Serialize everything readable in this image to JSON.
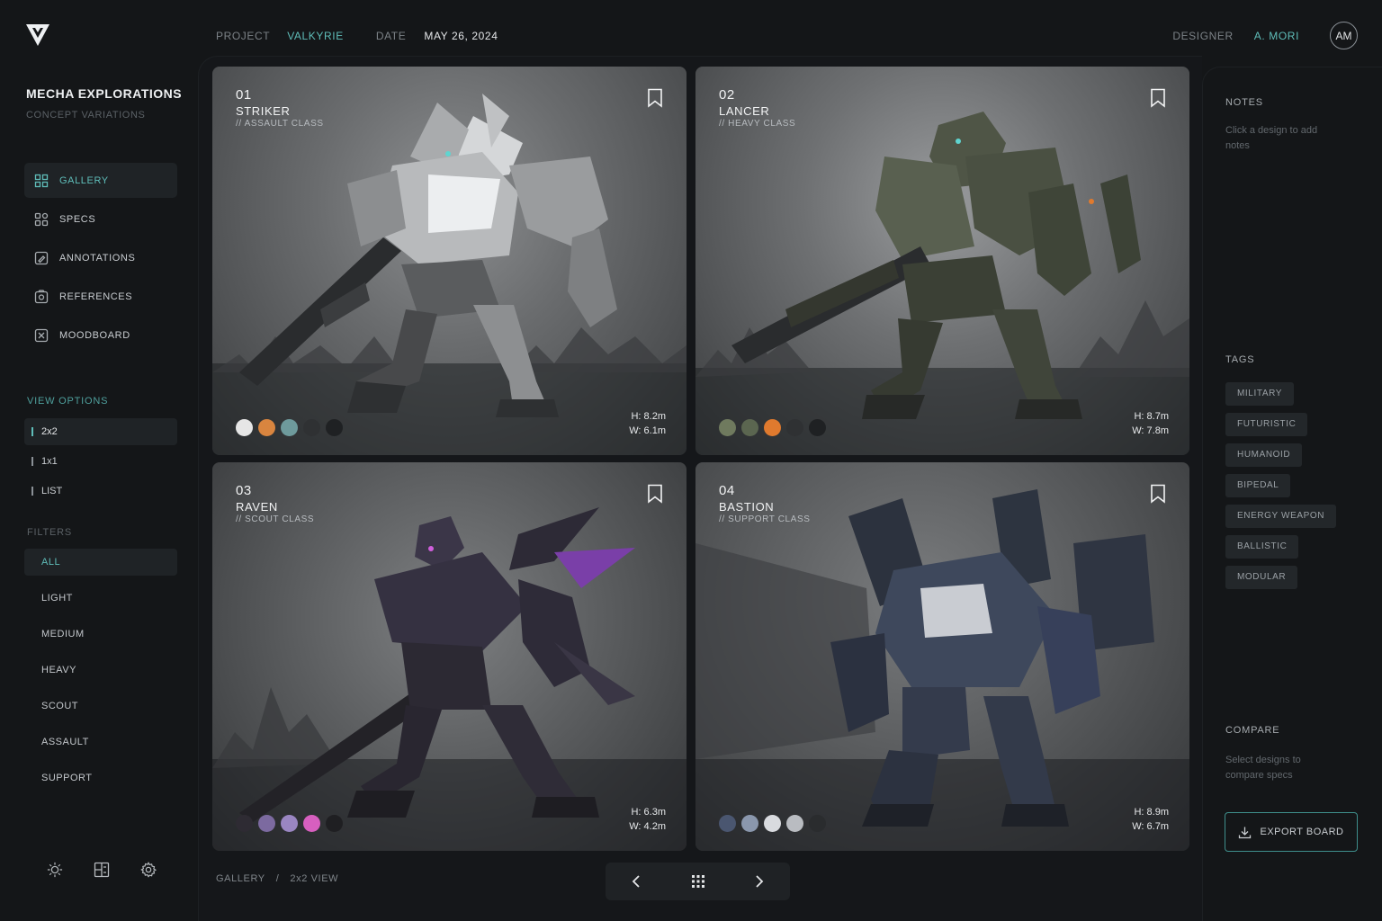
{
  "header": {
    "project_label": "PROJECT",
    "project_value": "VALKYRIE",
    "date_label": "DATE",
    "date_value": "MAY 26, 2024",
    "designer_label": "DESIGNER",
    "designer_value": "A. MORI",
    "avatar_initials": "AM"
  },
  "sidebar": {
    "title": "MECHA EXPLORATIONS",
    "subtitle": "CONCEPT VARIATIONS",
    "nav": [
      {
        "label": "GALLERY",
        "icon": "grid-icon",
        "active": true
      },
      {
        "label": "SPECS",
        "icon": "specs-grid-icon",
        "active": false
      },
      {
        "label": "ANNOTATIONS",
        "icon": "annotation-icon",
        "active": false
      },
      {
        "label": "REFERENCES",
        "icon": "reference-icon",
        "active": false
      },
      {
        "label": "MOODBOARD",
        "icon": "moodboard-icon",
        "active": false
      }
    ],
    "view_options_label": "VIEW OPTIONS",
    "view_options": [
      {
        "label": "2x2",
        "active": true
      },
      {
        "label": "1x1",
        "active": false
      },
      {
        "label": "LIST",
        "active": false
      }
    ],
    "filters_label": "FILTERS",
    "filters": [
      {
        "label": "ALL",
        "active": true
      },
      {
        "label": "LIGHT",
        "active": false
      },
      {
        "label": "MEDIUM",
        "active": false
      },
      {
        "label": "HEAVY",
        "active": false
      },
      {
        "label": "SCOUT",
        "active": false
      },
      {
        "label": "ASSAULT",
        "active": false
      },
      {
        "label": "SUPPORT",
        "active": false
      }
    ],
    "bottom_icons": [
      "sun-icon",
      "layout-icon",
      "settings-gear-icon"
    ]
  },
  "cards": [
    {
      "number": "01",
      "name": "STRIKER",
      "class": "// ASSAULT CLASS",
      "height": "H: 8.2m",
      "width": "W: 6.1m",
      "swatches": [
        "#e6e6e6",
        "#d9853f",
        "#6e9a9c",
        "#2f3133",
        "#1f2123"
      ]
    },
    {
      "number": "02",
      "name": "LANCER",
      "class": "// HEAVY CLASS",
      "height": "H: 8.7m",
      "width": "W: 7.8m",
      "swatches": [
        "#6f7a5e",
        "#5b6650",
        "#e07a2e",
        "#2f3133",
        "#1f2123"
      ]
    },
    {
      "number": "03",
      "name": "RAVEN",
      "class": "// SCOUT CLASS",
      "height": "H: 6.3m",
      "width": "W: 4.2m",
      "swatches": [
        "#2e2b33",
        "#7c6aa0",
        "#9a86c2",
        "#d75fbf",
        "#1f1f22"
      ]
    },
    {
      "number": "04",
      "name": "BASTION",
      "class": "// SUPPORT CLASS",
      "height": "H: 8.9m",
      "width": "W: 6.7m",
      "swatches": [
        "#4a5670",
        "#8a97ad",
        "#d9dbdf",
        "#b9bcc1",
        "#2a2c2e"
      ]
    }
  ],
  "footer": {
    "breadcrumb_root": "GALLERY",
    "breadcrumb_sep": "/",
    "breadcrumb_current": "2x2 VIEW",
    "pager_icons": [
      "chevron-left-icon",
      "grid-dots-icon",
      "chevron-right-icon"
    ]
  },
  "right_panel": {
    "notes_label": "NOTES",
    "notes_hint": "Click a design to add notes",
    "tags_label": "TAGS",
    "tags": [
      "MILITARY",
      "FUTURISTIC",
      "HUMANOID",
      "BIPEDAL",
      "ENERGY WEAPON",
      "BALLISTIC",
      "MODULAR"
    ],
    "compare_label": "COMPARE",
    "compare_hint": "Select designs to compare specs",
    "export_label": "EXPORT BOARD"
  },
  "colors": {
    "background": "#141618",
    "accent_teal": "#5fbdb9",
    "panel": "#1f2326"
  }
}
